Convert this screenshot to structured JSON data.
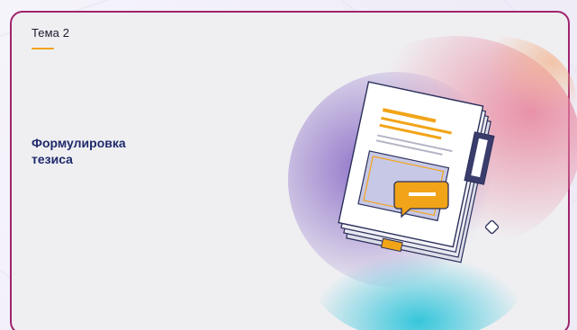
{
  "slide": {
    "topic_label": "Тема 2",
    "title_line1": "Формулировка",
    "title_line2": "тезиса"
  },
  "colors": {
    "frame_border": "#a0246e",
    "accent_underline": "#f2a418",
    "title_text": "#1f2a6b",
    "topic_text": "#1c1c2e"
  },
  "icons": {
    "illustration": "document-with-comment-illustration",
    "small_shapes": [
      "square-outline-shape",
      "diamond-shape"
    ]
  }
}
